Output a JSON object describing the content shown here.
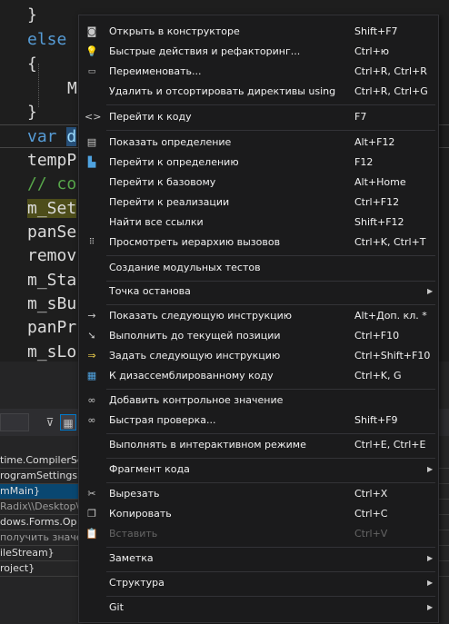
{
  "editor": {
    "lines": [
      {
        "text": "}"
      },
      {
        "text": "else"
      },
      {
        "text": "{"
      },
      {
        "text": "M"
      },
      {
        "text": "}"
      },
      {
        "text_kw": "var",
        "text": "d"
      },
      {
        "text": "tempP"
      },
      {
        "text": "// co"
      },
      {
        "text": "m_Set"
      },
      {
        "text": "panSe"
      },
      {
        "text": "remov"
      },
      {
        "text": "m_Sta"
      },
      {
        "text": "m_sBu"
      },
      {
        "text": "panPr"
      },
      {
        "text": "m_sLo"
      }
    ]
  },
  "output": {
    "rows": [
      "time.CompilerSe",
      "rogramSettings}",
      "mMain}",
      "Radix\\\\Desktop\\",
      "dows.Forms.Op",
      "получить значе",
      "ileStream}",
      "roject}"
    ]
  },
  "menu": {
    "items": [
      {
        "label": "Открыть в конструкторе",
        "shortcut": "Shift+F7",
        "icon": "designer-icon"
      },
      {
        "label": "Быстрые действия и рефакторинг...",
        "shortcut": "Ctrl+ю",
        "icon": "lightbulb-icon"
      },
      {
        "label": "Переименовать...",
        "shortcut": "Ctrl+R, Ctrl+R",
        "icon": "rename-icon"
      },
      {
        "label": "Удалить и отсортировать директивы using",
        "shortcut": "Ctrl+R, Ctrl+G",
        "icon": ""
      },
      {
        "label": "Перейти к коду",
        "shortcut": "F7",
        "icon": "code-icon"
      },
      {
        "label": "Показать определение",
        "shortcut": "Alt+F12",
        "icon": "peek-definition-icon"
      },
      {
        "label": "Перейти к определению",
        "shortcut": "F12",
        "icon": "go-to-definition-icon"
      },
      {
        "label": "Перейти к базовому",
        "shortcut": "Alt+Home",
        "icon": ""
      },
      {
        "label": "Перейти к реализации",
        "shortcut": "Ctrl+F12",
        "icon": ""
      },
      {
        "label": "Найти все ссылки",
        "shortcut": "Shift+F12",
        "icon": ""
      },
      {
        "label": "Просмотреть иерархию вызовов",
        "shortcut": "Ctrl+K, Ctrl+T",
        "icon": "call-hierarchy-icon"
      },
      {
        "label": "Создание модульных тестов",
        "shortcut": "",
        "icon": ""
      },
      {
        "label": "Точка останова",
        "shortcut": "",
        "icon": "",
        "submenu": true
      },
      {
        "label": "Показать следующую инструкцию",
        "shortcut": "Alt+Доп. кл. *",
        "icon": "arrow-right-icon"
      },
      {
        "label": "Выполнить до текущей позиции",
        "shortcut": "Ctrl+F10",
        "icon": "run-to-cursor-icon"
      },
      {
        "label": "Задать следующую инструкцию",
        "shortcut": "Ctrl+Shift+F10",
        "icon": "set-next-statement-icon"
      },
      {
        "label": "К дизассемблированному коду",
        "shortcut": "Ctrl+K, G",
        "icon": "disassembly-icon"
      },
      {
        "label": "Добавить контрольное значение",
        "shortcut": "",
        "icon": "glasses-icon"
      },
      {
        "label": "Быстрая проверка...",
        "shortcut": "Shift+F9",
        "icon": "glasses-icon"
      },
      {
        "label": "Выполнять в интерактивном режиме",
        "shortcut": "Ctrl+E, Ctrl+E",
        "icon": ""
      },
      {
        "label": "Фрагмент кода",
        "shortcut": "",
        "icon": "",
        "submenu": true
      },
      {
        "label": "Вырезать",
        "shortcut": "Ctrl+X",
        "icon": "scissors-icon"
      },
      {
        "label": "Копировать",
        "shortcut": "Ctrl+C",
        "icon": "copy-icon"
      },
      {
        "label": "Вставить",
        "shortcut": "Ctrl+V",
        "icon": "paste-icon",
        "disabled": true
      },
      {
        "label": "Заметка",
        "shortcut": "",
        "icon": "",
        "submenu": true
      },
      {
        "label": "Структура",
        "shortcut": "",
        "icon": "",
        "submenu": true
      },
      {
        "label": "Git",
        "shortcut": "",
        "icon": "",
        "submenu": true
      }
    ],
    "submenu_arrow": "▶"
  },
  "colors": {
    "menu_bg": "#1b1b1c",
    "editor_bg": "#1e1e1e",
    "keyword": "#569cd6",
    "comment": "#57a64a",
    "selection": "#094771"
  }
}
